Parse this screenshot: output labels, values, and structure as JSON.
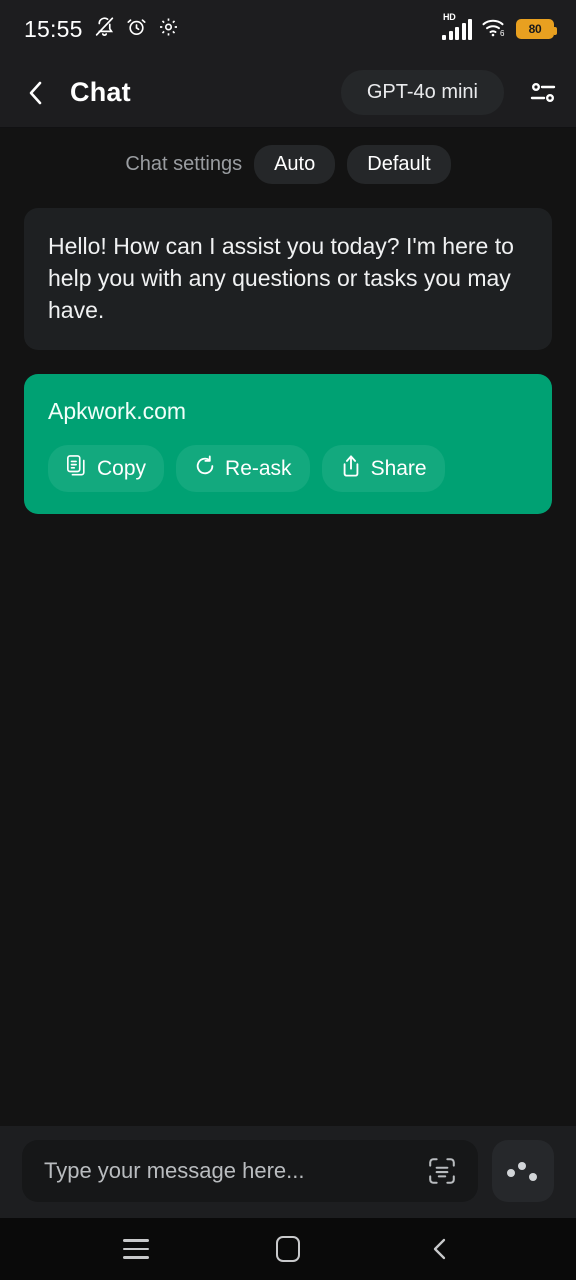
{
  "status_bar": {
    "time": "15:55",
    "icons_left": [
      "bell-mute-icon",
      "alarm-icon",
      "gear-icon"
    ],
    "network_label": "HD",
    "wifi_label": "6",
    "battery_level": "80",
    "battery_color": "#e8a020"
  },
  "header": {
    "back_label": "back-chevron",
    "title": "Chat",
    "model": "GPT-4o mini",
    "settings_icon": "sliders-icon"
  },
  "chat_settings": {
    "label": "Chat settings",
    "chips": [
      {
        "label": "Auto"
      },
      {
        "label": "Default"
      }
    ]
  },
  "messages": [
    {
      "role": "assistant",
      "text": "Hello! How can I assist you today? I'm here to help you with any questions or tasks you may have.",
      "background": "#1e2022"
    },
    {
      "role": "user",
      "text": "Apkwork.com",
      "background": "#00a173",
      "actions": [
        {
          "label": "Copy",
          "icon": "copy-icon"
        },
        {
          "label": "Re-ask",
          "icon": "refresh-icon"
        },
        {
          "label": "Share",
          "icon": "share-icon"
        }
      ]
    }
  ],
  "composer": {
    "placeholder": "Type your message here...",
    "value": "",
    "scan_icon": "scan-document-icon",
    "assist_icon": "three-dots-icon"
  },
  "nav_bar": {
    "recents": "recents-icon",
    "home": "home-icon",
    "back": "back-icon"
  },
  "colors": {
    "accent_green": "#00a173",
    "accent_green_light": "#13a97e",
    "background": "#131313",
    "surface": "#1d1d1f",
    "chip": "#252729"
  }
}
